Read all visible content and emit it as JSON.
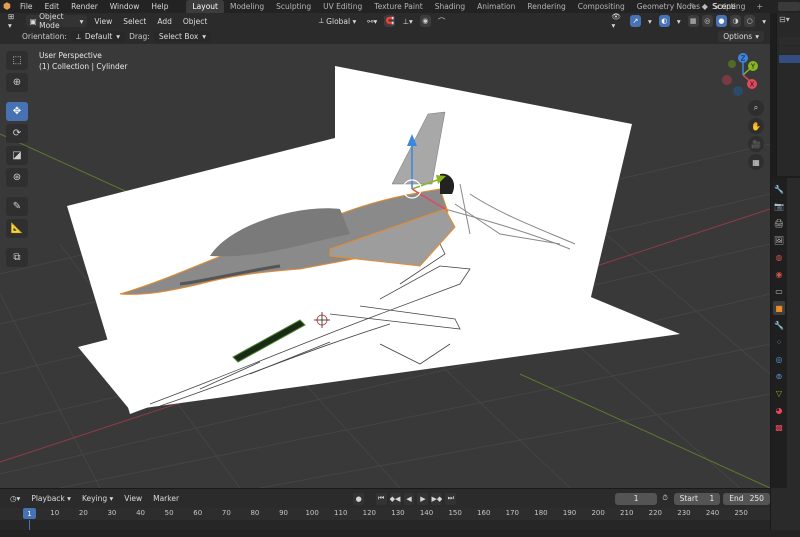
{
  "menu": [
    "File",
    "Edit",
    "Render",
    "Window",
    "Help"
  ],
  "workspaces": [
    "Layout",
    "Modeling",
    "Sculpting",
    "UV Editing",
    "Texture Paint",
    "Shading",
    "Animation",
    "Rendering",
    "Compositing",
    "Geometry Nodes",
    "Scripting"
  ],
  "active_workspace": "Layout",
  "scene": {
    "name": "Scene"
  },
  "header": {
    "mode": "Object Mode",
    "menus": [
      "View",
      "Select",
      "Add",
      "Object"
    ],
    "transform_orientation": "Global"
  },
  "tool_settings": {
    "orientation_label": "Orientation:",
    "orientation_value": "Default",
    "drag_label": "Drag:",
    "drag_value": "Select Box",
    "options": "Options"
  },
  "viewport": {
    "view_name": "User Perspective",
    "collection_info": "(1) Collection | Cylinder"
  },
  "gizmo": {
    "x": "X",
    "y": "Y",
    "z": "Z"
  },
  "timeline": {
    "menus": [
      "Playback",
      "Keying",
      "View",
      "Marker"
    ],
    "current_frame": "1",
    "start_label": "Start",
    "start": "1",
    "end_label": "End",
    "end": "250",
    "ticks": [
      "1",
      "10",
      "20",
      "30",
      "40",
      "50",
      "60",
      "70",
      "80",
      "90",
      "100",
      "110",
      "120",
      "130",
      "140",
      "150",
      "160",
      "170",
      "180",
      "190",
      "200",
      "210",
      "220",
      "230",
      "240",
      "250"
    ]
  },
  "colors": {
    "accent": "#4772b3",
    "x_axis": "#e5475d",
    "y_axis": "#89b620",
    "z_axis": "#3c86e0",
    "selection_outline": "#e88b2b"
  }
}
